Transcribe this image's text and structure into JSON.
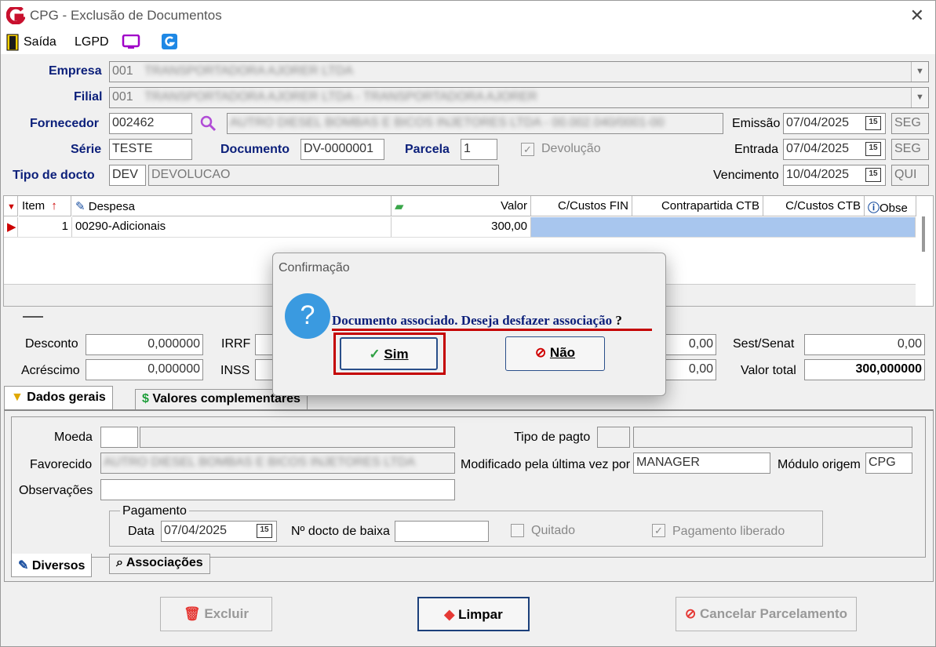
{
  "window": {
    "title": "CPG - Exclusão de Documentos",
    "close": "✕"
  },
  "toolbar": {
    "exit": "Saída",
    "lgpd": "LGPD"
  },
  "form": {
    "empresa": {
      "label": "Empresa",
      "code": "001",
      "name": "TRANSPORTADORA AJORER LTDA"
    },
    "filial": {
      "label": "Filial",
      "code": "001",
      "name": "TRANSPORTADORA AJORER LTDA - TRANSPORTADORA AJORER"
    },
    "fornecedor": {
      "label": "Fornecedor",
      "code": "002462",
      "name": "AUTRO DIESEL BOMBAS E BICOS INJETORES LTDA - 00.002.040/0001-00"
    },
    "serie": {
      "label": "Série",
      "value": "TESTE"
    },
    "documento": {
      "label": "Documento",
      "value": "DV-0000001"
    },
    "parcela": {
      "label": "Parcela",
      "value": "1"
    },
    "devolucao": {
      "label": "Devolução",
      "checked": "✓"
    },
    "tipo": {
      "label": "Tipo de docto",
      "code": "DEV",
      "desc": "DEVOLUCAO"
    },
    "emissao": {
      "label": "Emissão",
      "date": "07/04/2025",
      "day": "SEG"
    },
    "entrada": {
      "label": "Entrada",
      "date": "07/04/2025",
      "day": "SEG"
    },
    "vencimento": {
      "label": "Vencimento",
      "date": "10/04/2025",
      "day": "QUI"
    },
    "cal_icon": "15"
  },
  "grid": {
    "headers": {
      "item": "Item",
      "despesa": "Despesa",
      "valor": "Valor",
      "ccfin": "C/Custos FIN",
      "contra": "Contrapartida CTB",
      "ccctb": "C/Custos CTB",
      "obs": "Obse"
    },
    "row": {
      "item": "1",
      "despesa": "00290-Adicionais",
      "valor": "300,00"
    }
  },
  "totals": {
    "desconto_label": "Desconto",
    "desconto": "0,000000",
    "acrescimo_label": "Acréscimo",
    "acrescimo": "0,000000",
    "irrf_label": "IRRF",
    "inss_label": "INSS",
    "mid1": "0,00",
    "mid2": "0,00",
    "sest_label": "Sest/Senat",
    "sest": "0,00",
    "total_label": "Valor total",
    "total": "300,000000"
  },
  "tabs": {
    "dados": "Dados gerais",
    "valores": "Valores complementares",
    "diversos": "Diversos",
    "assoc": "Associações"
  },
  "panel": {
    "moeda": "Moeda",
    "tipo_pagto": "Tipo de pagto",
    "favorecido": "Favorecido",
    "favorecido_val": "AUTRO DIESEL BOMBAS E BICOS INJETORES LTDA",
    "modificado": "Modificado pela última vez por",
    "modificado_val": "MANAGER",
    "modulo": "Módulo origem",
    "modulo_val": "CPG",
    "obs": "Observações",
    "pagamento": "Pagamento",
    "data": "Data",
    "data_val": "07/04/2025",
    "nbaixa": "Nº docto de baixa",
    "quitado": "Quitado",
    "liberado": "Pagamento liberado",
    "liberado_check": "✓"
  },
  "buttons": {
    "excluir": "Excluir",
    "limpar": "Limpar",
    "cancelar": "Cancelar Parcelamento"
  },
  "dialog": {
    "title": "Confirmação",
    "icon": "?",
    "message": "Documento associado. Deseja desfazer associação",
    "qmark": "?",
    "yes": "Sim",
    "no": "Não"
  }
}
